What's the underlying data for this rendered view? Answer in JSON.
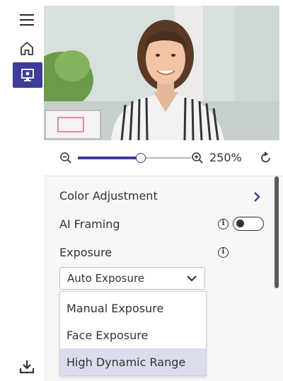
{
  "sidebar": {
    "items": [
      {
        "icon": "menu-icon"
      },
      {
        "icon": "home-icon"
      },
      {
        "icon": "camera-view-icon"
      },
      {
        "icon": "download-icon"
      }
    ],
    "accent": "#3d3d9a"
  },
  "zoom": {
    "value_label": "250%",
    "slider_fraction": 0.55
  },
  "settings": {
    "color_adjustment_label": "Color Adjustment",
    "ai_framing_label": "AI Framing",
    "ai_framing_on": false,
    "exposure_label": "Exposure",
    "exposure_selected": "Auto Exposure",
    "exposure_options": [
      "Manual Exposure",
      "Face Exposure",
      "High Dynamic Range"
    ],
    "highlighted_option": "High Dynamic Range"
  }
}
